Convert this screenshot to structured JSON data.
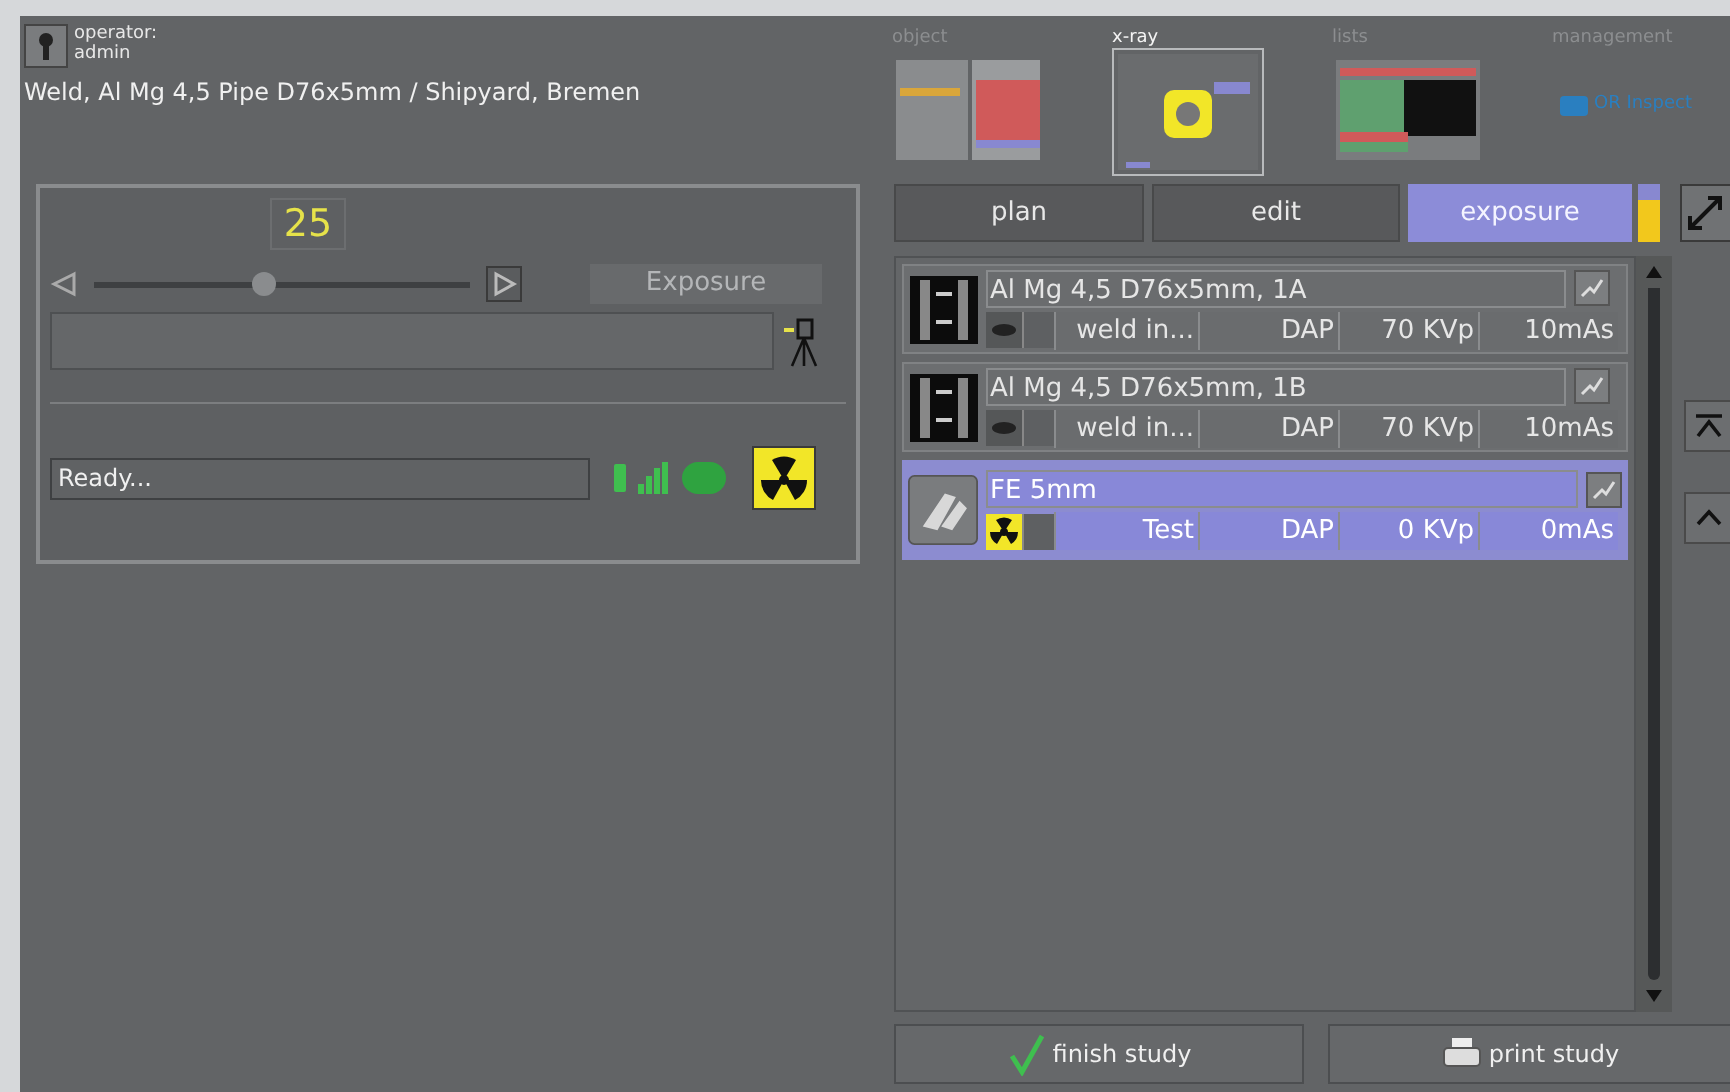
{
  "header": {
    "operator_label": "operator:",
    "operator_name": "admin",
    "title": "Weld, Al Mg 4,5 Pipe D76x5mm / Shipyard, Bremen"
  },
  "nav": [
    {
      "label": "object",
      "kind": "object",
      "selected": false
    },
    {
      "label": "x-ray",
      "kind": "xray",
      "selected": true
    },
    {
      "label": "lists",
      "kind": "lists",
      "selected": false
    },
    {
      "label": "management",
      "kind": "logo",
      "selected": false,
      "logo_text": "OR Inspect"
    }
  ],
  "exposure_panel": {
    "value": "25",
    "slider": {
      "level": 0.45
    },
    "exposure_button": {
      "label": "Exposure",
      "disabled": true
    },
    "status": "Ready..."
  },
  "tabs": [
    {
      "label": "plan",
      "selected": false
    },
    {
      "label": "edit",
      "selected": false
    },
    {
      "label": "exposure",
      "selected": true
    }
  ],
  "progress": {
    "level": 0.72
  },
  "rows": [
    {
      "kind": "image",
      "title": "Al Mg 4,5 D76x5mm, 1A",
      "cells": [
        "weld in...",
        "DAP",
        "70 KVp",
        "10mAs"
      ],
      "selected": false
    },
    {
      "kind": "image",
      "title": "Al Mg 4,5 D76x5mm, 1B",
      "cells": [
        "weld in...",
        "DAP",
        "70 KVp",
        "10mAs"
      ],
      "selected": false
    },
    {
      "kind": "pending",
      "title": "FE 5mm",
      "cells": [
        "Test",
        "DAP",
        "0 KVp",
        "0mAs"
      ],
      "selected": true
    }
  ],
  "buttons": [
    {
      "label": "finish study",
      "kind": "finish"
    },
    {
      "label": "print study",
      "kind": "print"
    }
  ]
}
